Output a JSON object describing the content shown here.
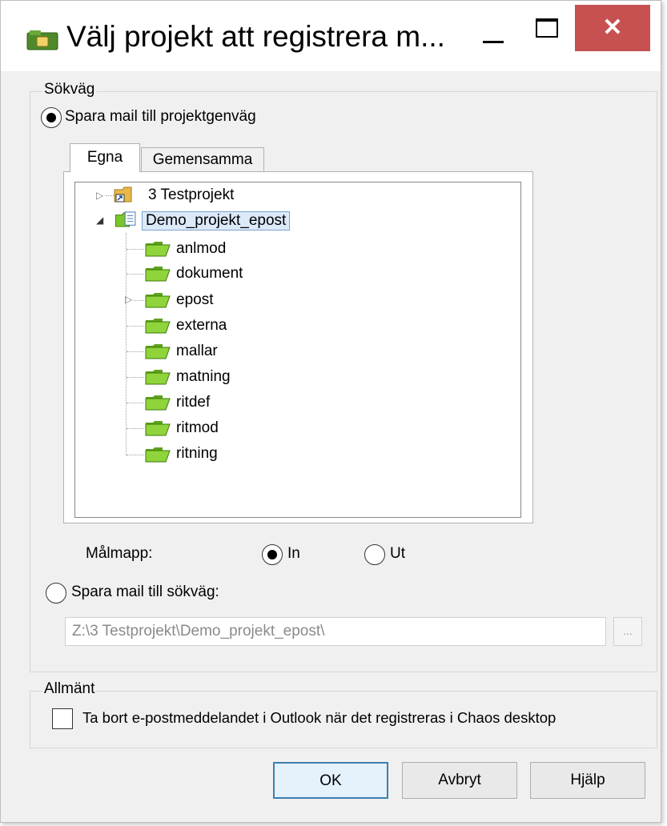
{
  "window": {
    "title": "Välj projekt att registrera m...",
    "close_glyph": "✕"
  },
  "path_group": {
    "legend": "Sökväg",
    "radio_shortcut_label": "Spara mail till projektgenväg",
    "radio_shortcut_checked": true,
    "tabs": [
      {
        "label": "Egna",
        "active": true
      },
      {
        "label": "Gemensamma",
        "active": false
      }
    ],
    "tree": {
      "nodes": [
        {
          "label": "3 Testprojekt",
          "icon": "project-shortcut-icon",
          "level": 0,
          "expandable": true,
          "expanded": false
        },
        {
          "label": "Demo_projekt_epost",
          "icon": "project-folder-icon",
          "level": 0,
          "expandable": true,
          "expanded": true,
          "selected": true
        },
        {
          "label": "anlmod",
          "icon": "folder-icon",
          "level": 1
        },
        {
          "label": "dokument",
          "icon": "folder-icon",
          "level": 1
        },
        {
          "label": "epost",
          "icon": "folder-icon",
          "level": 1,
          "expandable": true,
          "expanded": false
        },
        {
          "label": "externa",
          "icon": "folder-icon",
          "level": 1
        },
        {
          "label": "mallar",
          "icon": "folder-icon",
          "level": 1
        },
        {
          "label": "matning",
          "icon": "folder-icon",
          "level": 1
        },
        {
          "label": "ritdef",
          "icon": "folder-icon",
          "level": 1
        },
        {
          "label": "ritmod",
          "icon": "folder-icon",
          "level": 1
        },
        {
          "label": "ritning",
          "icon": "folder-icon",
          "level": 1
        }
      ]
    },
    "target_folder_label": "Målmapp:",
    "target_in_label": "In",
    "target_in_checked": true,
    "target_out_label": "Ut",
    "target_out_checked": false,
    "radio_path_label": "Spara mail till sökväg:",
    "radio_path_checked": false,
    "path_value": "Z:\\3 Testprojekt\\Demo_projekt_epost\\",
    "browse_label": "..."
  },
  "general_group": {
    "legend": "Allmänt",
    "delete_checkbox_label": "Ta bort e-postmeddelandet i Outlook när det registreras i Chaos desktop",
    "delete_checked": false
  },
  "buttons": {
    "ok": "OK",
    "cancel": "Avbryt",
    "help": "Hjälp"
  },
  "colors": {
    "folder_green": "#7bc62d",
    "close_red": "#c75050",
    "selection_blue": "#dce9f8"
  }
}
